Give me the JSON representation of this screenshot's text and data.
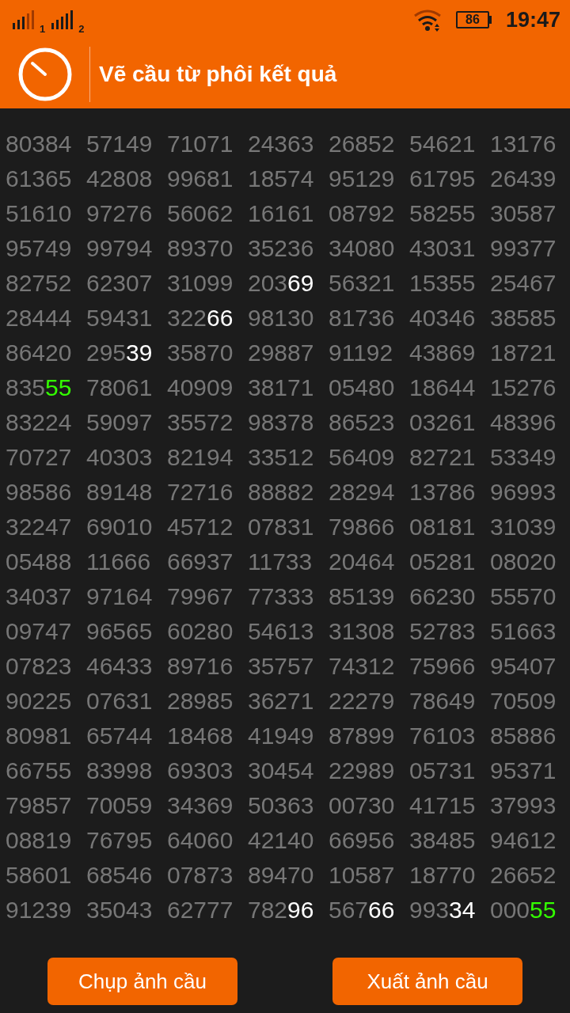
{
  "status_bar": {
    "sim_1": "1",
    "sim_2": "2",
    "battery": "86",
    "time": "19:47"
  },
  "app_bar": {
    "title": "Vẽ cầu từ phôi kết quả"
  },
  "grid": {
    "rows": [
      [
        "80384",
        "57149",
        "71071",
        "24363",
        "26852",
        "54621",
        "13176"
      ],
      [
        "61365",
        "42808",
        "99681",
        "18574",
        "95129",
        "61795",
        "26439"
      ],
      [
        "51610",
        "97276",
        "56062",
        "16161",
        "08792",
        "58255",
        "30587"
      ],
      [
        "95749",
        "99794",
        "89370",
        "35236",
        "34080",
        "43031",
        "99377"
      ],
      [
        "82752",
        "62307",
        "31099",
        {
          "text": "203",
          "highlight": "69",
          "color": "#ffffff"
        },
        "56321",
        "15355",
        "25467"
      ],
      [
        "28444",
        "59431",
        {
          "text": "322",
          "highlight": "66",
          "color": "#ffffff"
        },
        "98130",
        "81736",
        "40346",
        "38585"
      ],
      [
        "86420",
        {
          "text": "295",
          "highlight": "39",
          "color": "#ffffff"
        },
        "35870",
        "29887",
        "91192",
        "43869",
        "18721"
      ],
      [
        {
          "text": "835",
          "highlight": "55",
          "color": "#33ff00"
        },
        "78061",
        "40909",
        "38171",
        "05480",
        "18644",
        "15276"
      ],
      [
        "83224",
        "59097",
        "35572",
        "98378",
        "86523",
        "03261",
        "48396"
      ],
      [
        "70727",
        "40303",
        "82194",
        "33512",
        "56409",
        "82721",
        "53349"
      ],
      [
        "98586",
        "89148",
        "72716",
        "88882",
        "28294",
        "13786",
        "96993"
      ],
      [
        "32247",
        "69010",
        "45712",
        "07831",
        "79866",
        "08181",
        "31039"
      ],
      [
        "05488",
        "11666",
        "66937",
        "11733",
        "20464",
        "05281",
        "08020"
      ],
      [
        "34037",
        "97164",
        "79967",
        "77333",
        "85139",
        "66230",
        "55570"
      ],
      [
        "09747",
        "96565",
        "60280",
        "54613",
        "31308",
        "52783",
        "51663"
      ],
      [
        "07823",
        "46433",
        "89716",
        "35757",
        "74312",
        "75966",
        "95407"
      ],
      [
        "90225",
        "07631",
        "28985",
        "36271",
        "22279",
        "78649",
        "70509"
      ],
      [
        "80981",
        "65744",
        "18468",
        "41949",
        "87899",
        "76103",
        "85886"
      ],
      [
        "66755",
        "83998",
        "69303",
        "30454",
        "22989",
        "05731",
        "95371"
      ],
      [
        "79857",
        "70059",
        "34369",
        "50363",
        "00730",
        "41715",
        "37993"
      ],
      [
        "08819",
        "76795",
        "64060",
        "42140",
        "66956",
        "38485",
        "94612"
      ],
      [
        "58601",
        "68546",
        "07873",
        "89470",
        "10587",
        "18770",
        "26652"
      ],
      [
        "91239",
        "35043",
        "62777",
        {
          "text": "782",
          "highlight": "96",
          "color": "#ffffff"
        },
        {
          "text": "567",
          "highlight": "66",
          "color": "#ffffff"
        },
        {
          "text": "993",
          "highlight": "34",
          "color": "#ffffff"
        },
        {
          "text": "000",
          "highlight": "55",
          "color": "#33ff00"
        }
      ]
    ]
  },
  "buttons": [
    "Chụp ảnh cầu",
    "Xuất ảnh cầu"
  ]
}
